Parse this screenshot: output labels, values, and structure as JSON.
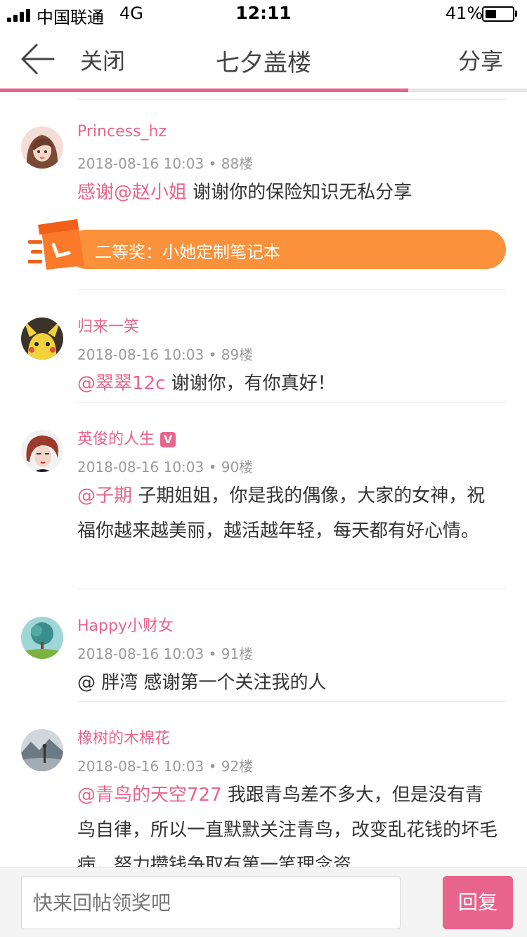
{
  "status_bar": {
    "carrier": "中国联通",
    "network": "4G",
    "time": "12:11",
    "battery_percent_text": "41%",
    "battery_level": 0.41
  },
  "nav": {
    "close_label": "关闭",
    "title": "七夕盖楼",
    "share_label": "分享",
    "read_progress": 0.775
  },
  "colors": {
    "accent_pink": "#e8648c",
    "prize_orange": "#fb913a",
    "meta_gray": "#9a9a9a"
  },
  "posts": [
    {
      "username": "Princess_hz",
      "meta": "2018-08-16 10:03 • 88楼",
      "content_mention": "感谢@赵小姐",
      "content_text": " 谢谢你的保险知识无私分享",
      "avatar_icon": "girl-avatar",
      "prize": "二等奖：小她定制笔记本"
    },
    {
      "username": "归来一笑",
      "meta": "2018-08-16 10:03 • 89楼",
      "content_mention": "@翠翠12c",
      "content_text": " 谢谢你，有你真好！",
      "avatar_icon": "pikachu-avatar"
    },
    {
      "username": "英俊的人生",
      "badge": "V",
      "meta": "2018-08-16 10:03 • 90楼",
      "content_mention": "@子期",
      "content_text": " 子期姐姐，你是我的偶像，大家的女神，祝福你越来越美丽，越活越年轻，每天都有好心情。",
      "avatar_icon": "redhair-avatar"
    },
    {
      "username": "Happy小财女",
      "meta": "2018-08-16 10:03 • 91楼",
      "content_text": "@ 胖湾 感谢第一个关注我的人",
      "avatar_icon": "tree-avatar"
    },
    {
      "username": "橡树的木棉花",
      "meta": "2018-08-16 10:03 • 92楼",
      "content_mention": "@青鸟的天空727",
      "content_text": " 我跟青鸟差不多大，但是没有青鸟自律，所以一直默默关注青鸟，改变乱花钱的坏毛病，努力攒钱争取有第一笔理念资",
      "avatar_icon": "landscape-avatar"
    }
  ],
  "reply_bar": {
    "placeholder": "快来回帖领奖吧",
    "button_label": "回复"
  }
}
